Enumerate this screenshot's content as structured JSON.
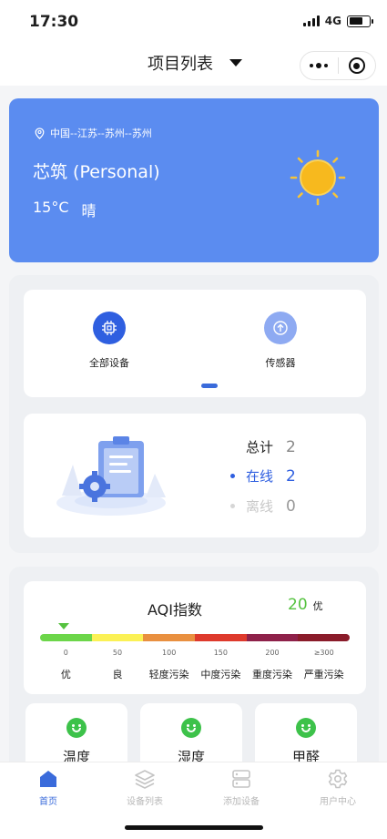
{
  "status_bar": {
    "time": "17:30",
    "network": "4G",
    "battery_level": 0.7
  },
  "nav": {
    "title": "项目列表"
  },
  "weather": {
    "location": "中国--江苏--苏州--苏州",
    "project": "芯筑 (Personal)",
    "temperature": "15°C",
    "condition": "晴",
    "icon": "sun-icon"
  },
  "devices": {
    "items": [
      {
        "label": "全部设备",
        "icon": "chip-icon",
        "color": "#2f5fe0"
      },
      {
        "label": "传感器",
        "icon": "upload-circle-icon",
        "color": "#8eaaf2"
      }
    ]
  },
  "stats": {
    "total_label": "总计",
    "total_value": "2",
    "online_label": "在线",
    "online_value": "2",
    "offline_label": "离线",
    "offline_value": "0"
  },
  "aqi": {
    "title": "AQI指数",
    "value": "20",
    "grade": "优",
    "ticks": [
      "0",
      "50",
      "100",
      "150",
      "200",
      "≥300"
    ],
    "levels": [
      "优",
      "良",
      "轻度污染",
      "中度污染",
      "重度污染",
      "严重污染"
    ],
    "colors": [
      "#6cd64a",
      "#fbf155",
      "#e99040",
      "#de3a2c",
      "#8e214a",
      "#8a1c2a"
    ]
  },
  "sensors": [
    "温度",
    "湿度",
    "甲醛"
  ],
  "tabs": [
    {
      "label": "首页",
      "icon": "home-icon"
    },
    {
      "label": "设备列表",
      "icon": "layers-icon"
    },
    {
      "label": "添加设备",
      "icon": "server-icon"
    },
    {
      "label": "用户中心",
      "icon": "gear-icon"
    }
  ]
}
